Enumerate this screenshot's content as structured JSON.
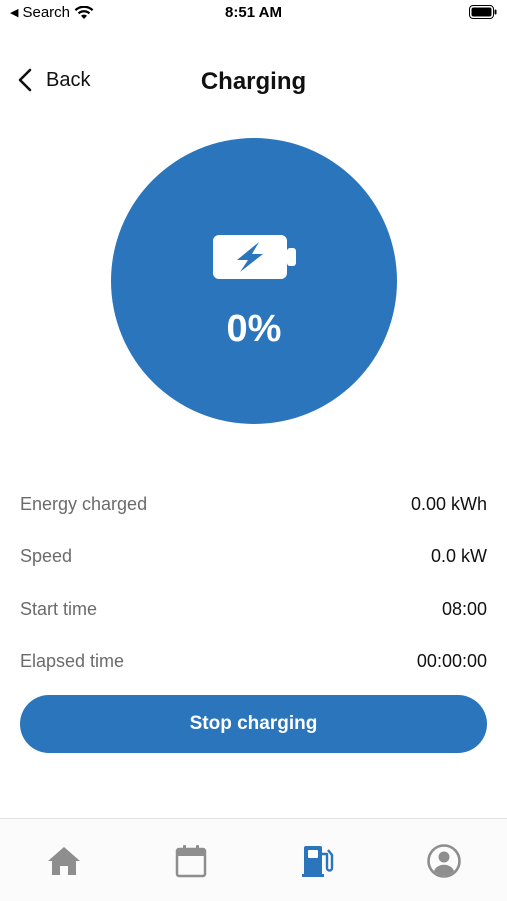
{
  "status_bar": {
    "back_app": "Search",
    "time": "8:51 AM"
  },
  "nav": {
    "back_label": "Back",
    "title": "Charging"
  },
  "gauge": {
    "percent_text": "0%",
    "charge_fraction": 0,
    "color": "#2a75bb",
    "icon": "battery-charging-icon"
  },
  "stats": [
    {
      "label": "Energy charged",
      "value": "0.00 kWh"
    },
    {
      "label": "Speed",
      "value": "0.0 kW"
    },
    {
      "label": "Start time",
      "value": "08:00"
    },
    {
      "label": "Elapsed time",
      "value": "00:00:00"
    }
  ],
  "actions": {
    "stop_label": "Stop charging"
  },
  "tabbar": {
    "items": [
      {
        "icon": "home-icon",
        "active": false
      },
      {
        "icon": "calendar-icon",
        "active": false
      },
      {
        "icon": "fuel-pump-icon",
        "active": true
      },
      {
        "icon": "profile-icon",
        "active": false
      }
    ],
    "active_color": "#2a75bb",
    "inactive_color": "#8e8e8e"
  }
}
